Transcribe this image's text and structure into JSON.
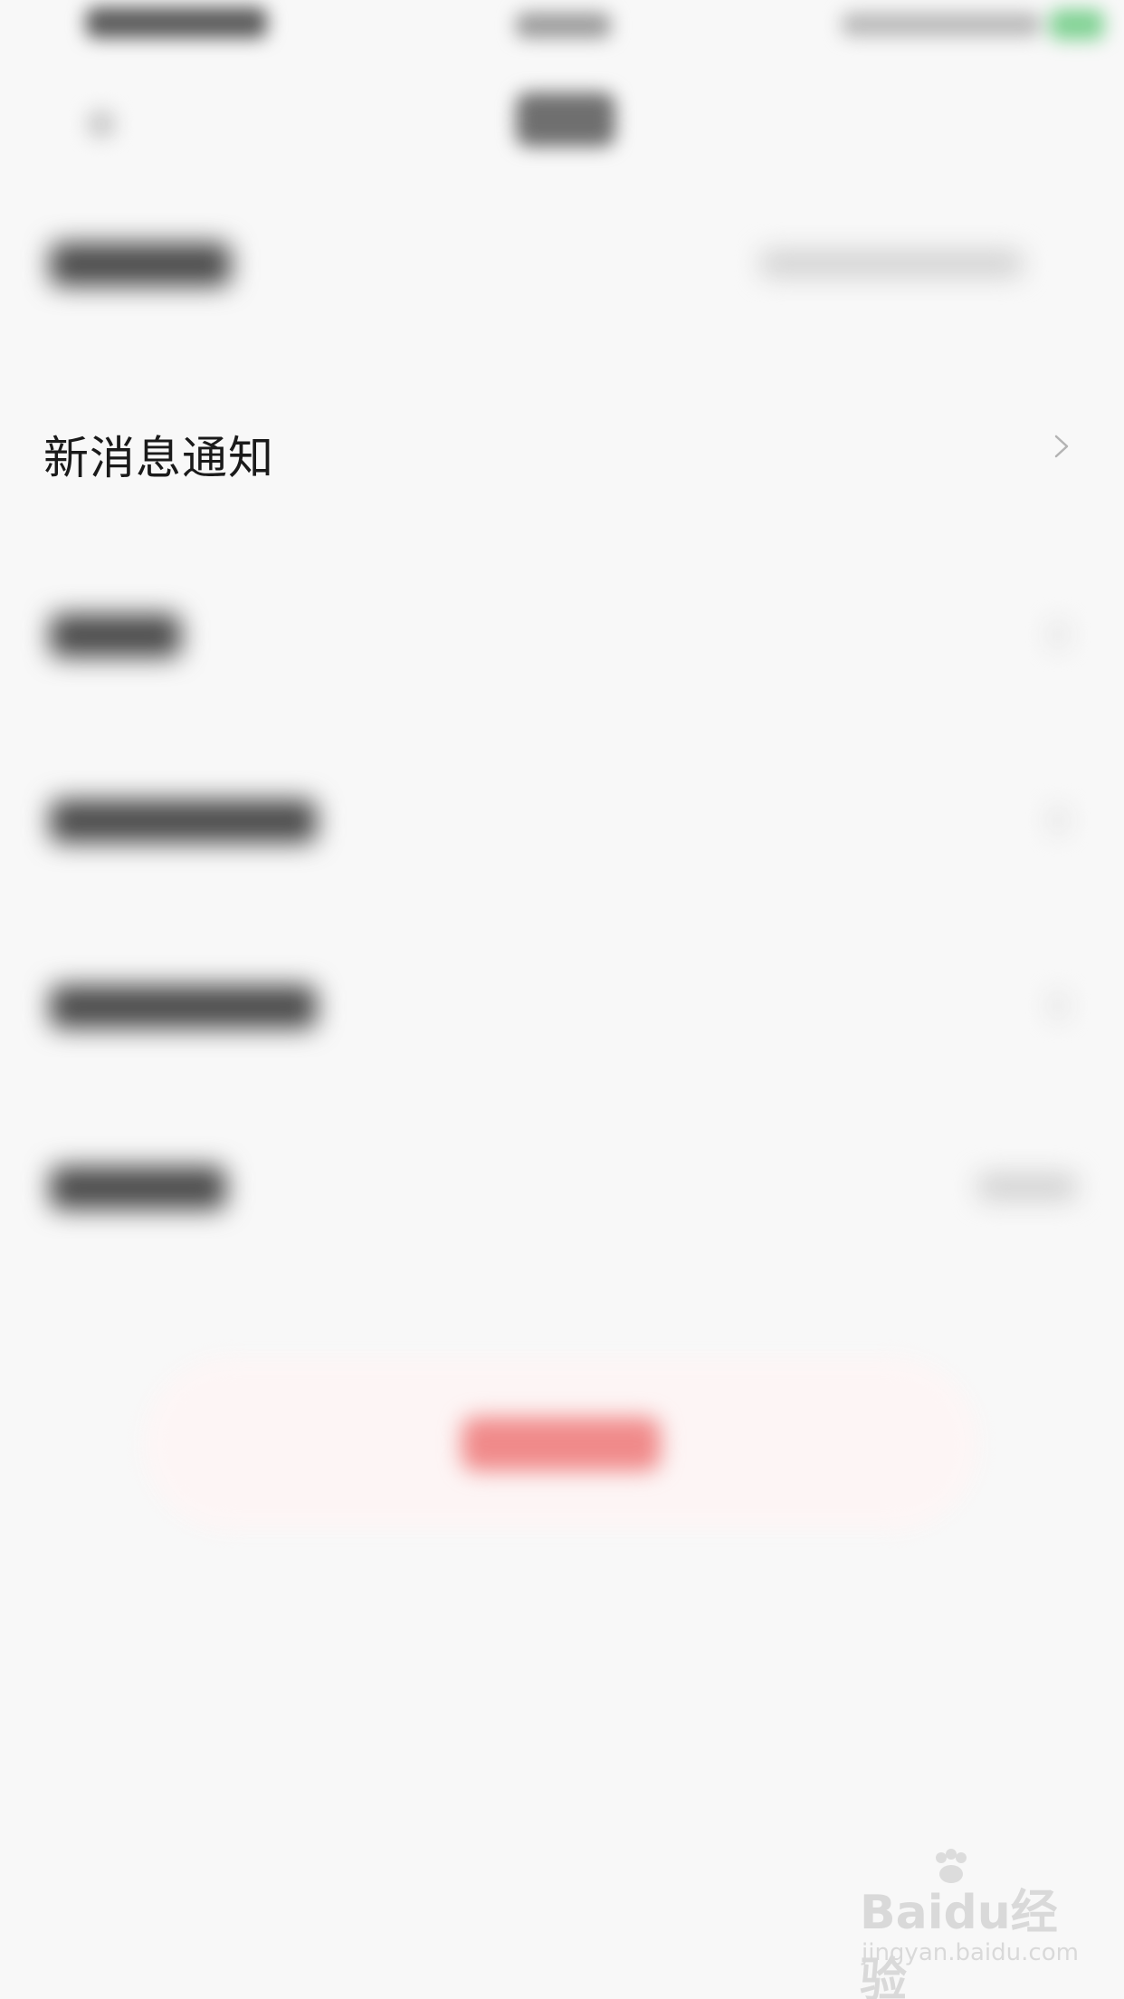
{
  "settings": {
    "notification_row": {
      "label": "新消息通知"
    }
  },
  "watermark": {
    "brand": "Baidu经验",
    "site": "jingyan.baidu.com"
  },
  "colors": {
    "status_battery": "#4ec26a",
    "logout_accent": "#f08a8a"
  }
}
